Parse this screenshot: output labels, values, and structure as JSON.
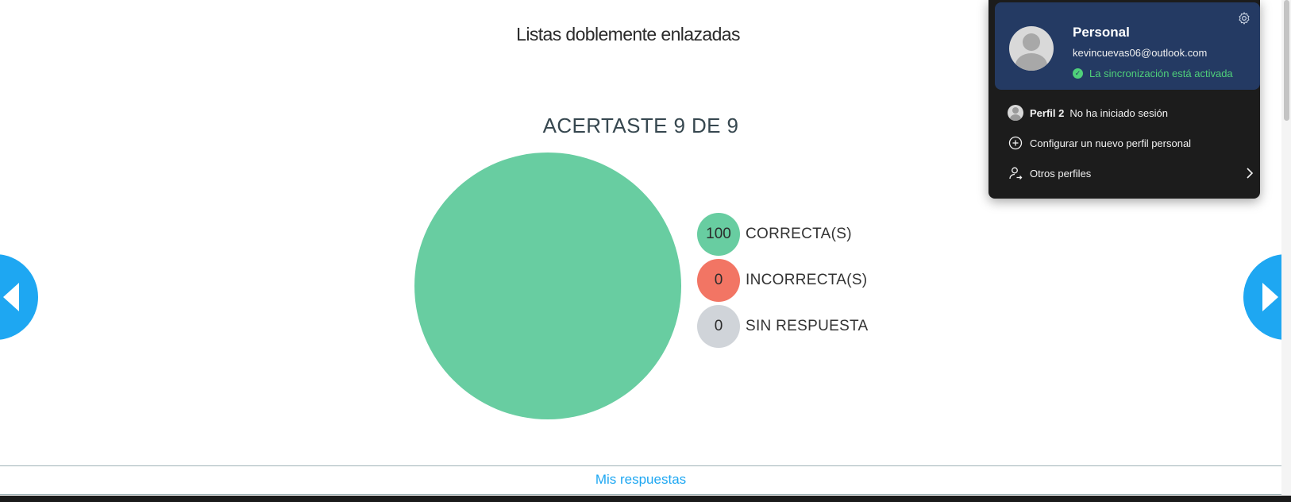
{
  "page": {
    "title": "Listas doblemente enlazadas",
    "score_title": "ACERTASTE 9 DE 9",
    "bottom_link": "Mis respuestas"
  },
  "chart_data": {
    "type": "pie",
    "slices": [
      {
        "label": "CORRECTA(S)",
        "value": 100,
        "color": "#68cda1"
      },
      {
        "label": "INCORRECTA(S)",
        "value": 0,
        "color": "#f27564"
      },
      {
        "label": "SIN RESPUESTA",
        "value": 0,
        "color": "#d0d4d9"
      }
    ],
    "legend": [
      {
        "value": "100",
        "label": "CORRECTA(S)",
        "color": "#68cda1"
      },
      {
        "value": "0",
        "label": "INCORRECTA(S)",
        "color": "#f27564"
      },
      {
        "value": "0",
        "label": "SIN RESPUESTA",
        "color": "#d0d4d9"
      }
    ],
    "legend_position": "right"
  },
  "navigation": {
    "prev_icon": "triangle-left-icon",
    "next_icon": "triangle-right-icon",
    "color": "#1ea7f2"
  },
  "profile_popup": {
    "name": "Personal",
    "email": "kevincuevas06@outlook.com",
    "sync_status": "La sincronización está activada",
    "settings_icon": "gear-icon",
    "profile2_name": "Perfil 2",
    "profile2_status": "No ha iniciado sesión",
    "add_profile_label": "Configurar un nuevo perfil personal",
    "other_profiles_label": "Otros perfiles",
    "card_color": "#243a63",
    "sync_color": "#4fd07a"
  }
}
